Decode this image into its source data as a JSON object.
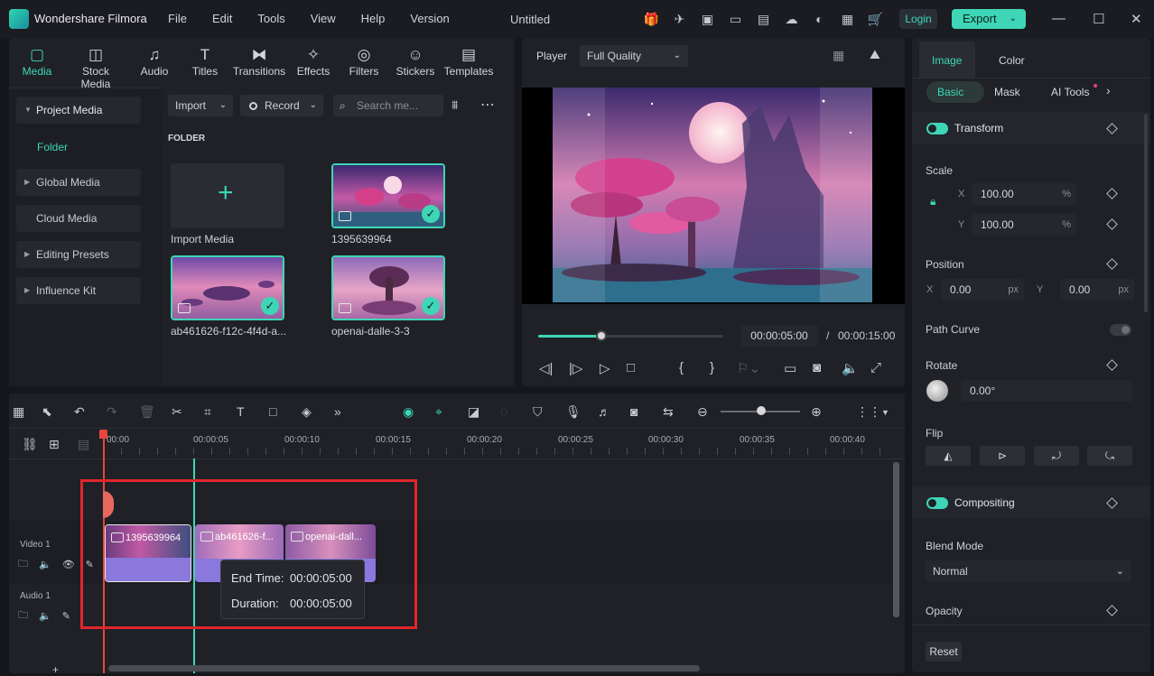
{
  "app": {
    "name": "Wondershare Filmora",
    "document_title": "Untitled"
  },
  "menu": [
    "File",
    "Edit",
    "Tools",
    "View",
    "Help",
    "Version"
  ],
  "header": {
    "login_label": "Login",
    "export_label": "Export"
  },
  "tool_tabs": [
    "Media",
    "Stock Media",
    "Audio",
    "Titles",
    "Transitions",
    "Effects",
    "Filters",
    "Stickers",
    "Templates"
  ],
  "sidebar": {
    "items": [
      {
        "label": "Project Media"
      },
      {
        "label": "Folder"
      },
      {
        "label": "Global Media"
      },
      {
        "label": "Cloud Media"
      },
      {
        "label": "Editing Presets"
      },
      {
        "label": "Influence Kit"
      }
    ]
  },
  "media_toolbar": {
    "import_label": "Import",
    "record_label": "Record",
    "search_placeholder": "Search me..."
  },
  "media": {
    "folder_heading": "FOLDER",
    "import_label": "Import Media",
    "items": [
      {
        "label": "1395639964"
      },
      {
        "label": "ab461626-f12c-4f4d-a..."
      },
      {
        "label": "openai-dalle-3-3"
      }
    ]
  },
  "player": {
    "label": "Player",
    "quality": "Full Quality",
    "current_time": "00:00:05:00",
    "separator": "/",
    "total_time": "00:00:15:00",
    "progress": 0.34
  },
  "props": {
    "tabs": [
      "Image",
      "Color"
    ],
    "subtabs": [
      "Basic",
      "Mask",
      "AI Tools"
    ],
    "transform_label": "Transform",
    "scale_label": "Scale",
    "scale_x_label": "X",
    "scale_y_label": "Y",
    "scale_x": "100.00",
    "scale_y": "100.00",
    "percent_unit": "%",
    "position_label": "Position",
    "pos_x_label": "X",
    "pos_y_label": "Y",
    "pos_x": "0.00",
    "pos_y": "0.00",
    "px_unit": "px",
    "path_curve_label": "Path Curve",
    "rotate_label": "Rotate",
    "rotate_value": "0.00°",
    "flip_label": "Flip",
    "compositing_label": "Compositing",
    "blend_mode_label": "Blend Mode",
    "blend_mode_value": "Normal",
    "opacity_label": "Opacity",
    "reset_label": "Reset"
  },
  "timeline": {
    "ruler": [
      "00:00",
      "00:00:05",
      "00:00:10",
      "00:00:15",
      "00:00:20",
      "00:00:25",
      "00:00:30",
      "00:00:35",
      "00:00:40"
    ],
    "tracks": [
      {
        "label": "Video 1"
      },
      {
        "label": "Audio 1"
      }
    ],
    "clips": [
      {
        "title": "1395639964"
      },
      {
        "title": "ab461626-f..."
      },
      {
        "title": "openai-dall..."
      }
    ],
    "tooltip": {
      "end_label": "End Time:",
      "end_value": "00:00:05:00",
      "duration_label": "Duration:",
      "duration_value": "00:00:05:00"
    }
  },
  "colors": {
    "accent": "#3ed6b6",
    "highlight": "#e0262c",
    "clip": "#8a78dd"
  }
}
